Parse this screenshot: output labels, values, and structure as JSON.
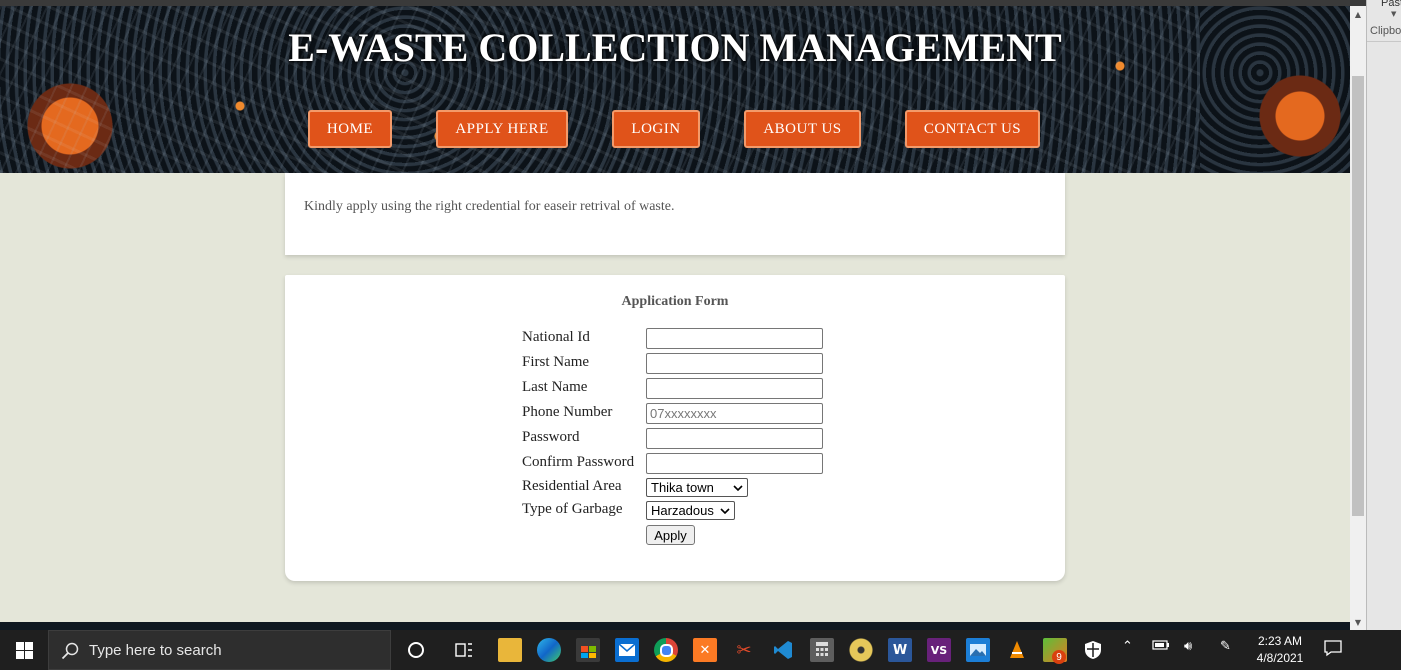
{
  "site": {
    "title": "E-WASTE COLLECTION MANAGEMENT"
  },
  "nav": [
    {
      "label": "HOME"
    },
    {
      "label": "APPLY HERE"
    },
    {
      "label": "LOGIN"
    },
    {
      "label": "ABOUT US"
    },
    {
      "label": "CONTACT US"
    }
  ],
  "intro_text": "Kindly apply using the right credential for easeir retrival of waste.",
  "form": {
    "title": "Application Form",
    "fields": [
      {
        "label": "National Id",
        "value": "",
        "placeholder": ""
      },
      {
        "label": "First Name",
        "value": "",
        "placeholder": ""
      },
      {
        "label": "Last Name",
        "value": "",
        "placeholder": ""
      },
      {
        "label": "Phone Number",
        "value": "",
        "placeholder": "07xxxxxxxx"
      },
      {
        "label": "Password",
        "value": "",
        "placeholder": ""
      },
      {
        "label": "Confirm Password",
        "value": "",
        "placeholder": ""
      }
    ],
    "residential_area": {
      "label": "Residential Area",
      "selected": "Thika town"
    },
    "garbage_type": {
      "label": "Type of Garbage",
      "selected": "Harzadous"
    },
    "submit_label": "Apply"
  },
  "peek_window": {
    "paste_label": "Past",
    "clipboard_label": "Clipbo"
  },
  "taskbar": {
    "search_placeholder": "Type here to search",
    "time": "2:23 AM",
    "date": "4/8/2021",
    "badge_count": "9",
    "apps": [
      "cortana-icon",
      "task-view-icon",
      "file-explorer-icon",
      "edge-icon",
      "store-icon",
      "mail-icon",
      "chrome-icon",
      "xampp-icon",
      "snipping-tool-icon",
      "vscode-icon",
      "calculator-icon",
      "media-icon",
      "word-icon",
      "visual-studio-icon",
      "photos-icon",
      "vlc-icon",
      "app-icon",
      "security-icon"
    ]
  },
  "colors": {
    "nav_button": "#e0531a",
    "page_background": "#e4e6d9",
    "taskbar": "#1f1f1f"
  }
}
